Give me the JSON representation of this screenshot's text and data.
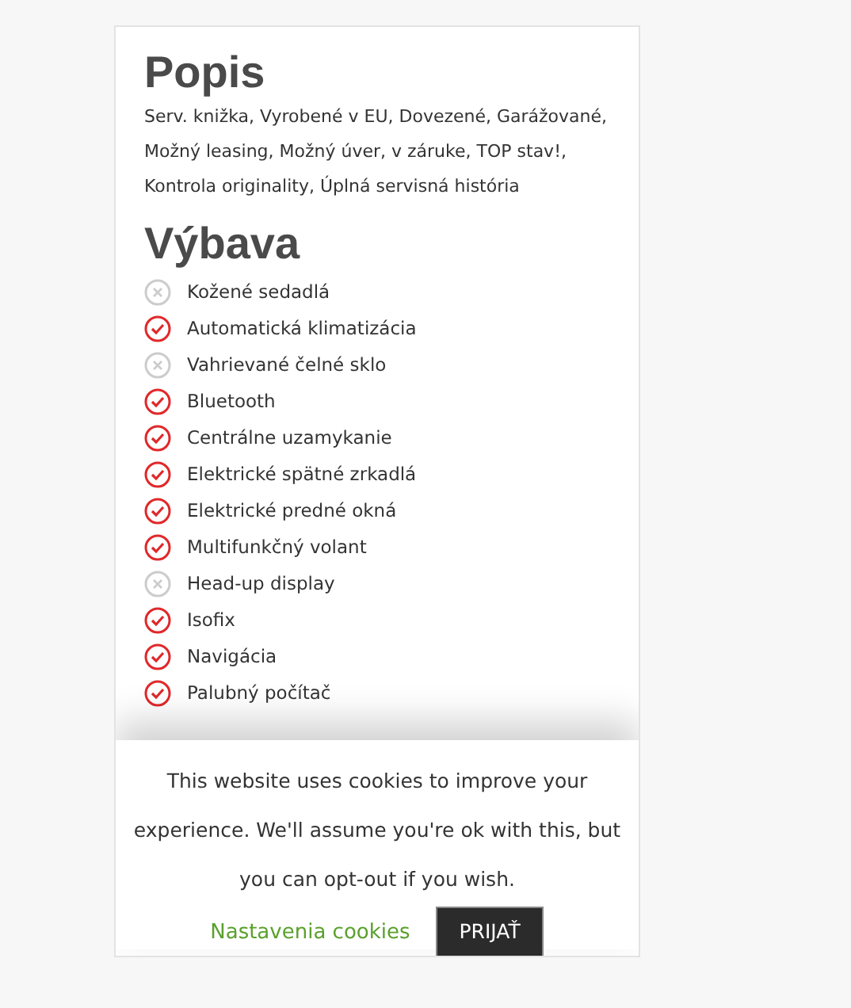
{
  "description": {
    "title": "Popis",
    "text": "Serv. knižka, Vyrobené v EU, Dovezené, Garážované, Možný leasing, Možný úver, v záruke, TOP stav!, Kontrola originality, Úplná servisná história"
  },
  "equipment": {
    "title": "Výbava",
    "items": [
      {
        "label": "Kožené sedadlá",
        "checked": false
      },
      {
        "label": "Automatická klimatizácia",
        "checked": true
      },
      {
        "label": "Vahrievané čelné sklo",
        "checked": false
      },
      {
        "label": "Bluetooth",
        "checked": true
      },
      {
        "label": "Centrálne uzamykanie",
        "checked": true
      },
      {
        "label": "Elektrické spätné zrkadlá",
        "checked": true
      },
      {
        "label": "Elektrické predné okná",
        "checked": true
      },
      {
        "label": "Multifunkčný volant",
        "checked": true
      },
      {
        "label": "Head-up display",
        "checked": false
      },
      {
        "label": "Isofix",
        "checked": true
      },
      {
        "label": "Navigácia",
        "checked": true
      },
      {
        "label": "Palubný počítač",
        "checked": true
      }
    ]
  },
  "cookie_banner": {
    "text": "This website uses cookies to improve your experience. We'll assume you're ok with this, but you can opt-out if you wish.",
    "settings_link": "Nastavenia cookies",
    "accept_button": "PRIJAŤ"
  }
}
